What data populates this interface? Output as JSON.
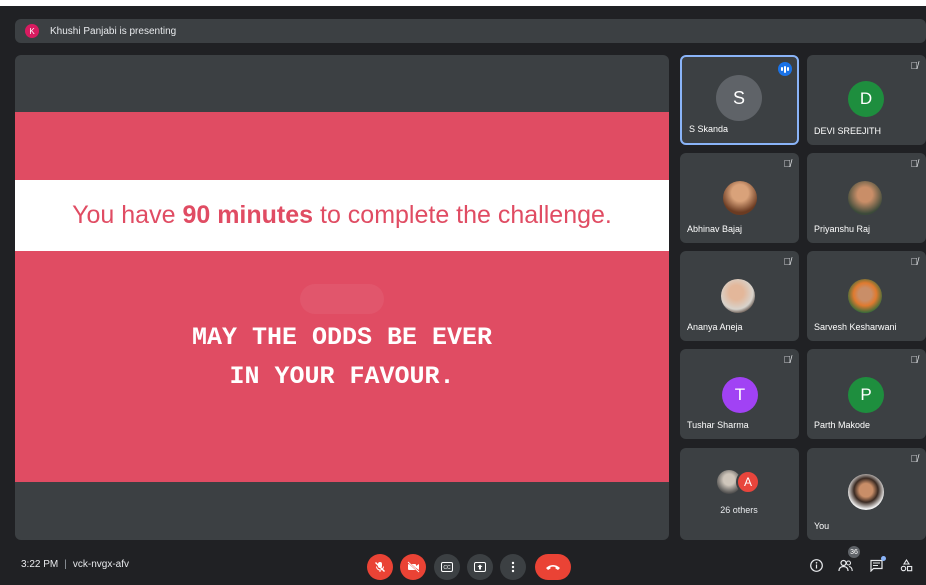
{
  "presentation_banner": {
    "avatar_letter": "K",
    "text": "Khushi Panjabi is presenting"
  },
  "slide": {
    "heading_pre": "You have ",
    "heading_bold": "90 minutes",
    "heading_post": " to complete the challenge.",
    "line1": "MAY THE ODDS BE EVER",
    "line2": "IN YOUR FAVOUR."
  },
  "participants": [
    {
      "name": "S Skanda",
      "initial": "S",
      "avatar_color": "#5f6368",
      "speaking": true
    },
    {
      "name": "DEVI SREEJITH",
      "initial": "D",
      "avatar_color": "#1e8e3e"
    },
    {
      "name": "Abhinav Bajaj"
    },
    {
      "name": "Priyanshu Raj"
    },
    {
      "name": "Ananya Aneja"
    },
    {
      "name": "Sarvesh Kesharwani"
    },
    {
      "name": "Tushar Sharma",
      "initial": "T",
      "avatar_color": "#a142f4"
    },
    {
      "name": "Parth Makode",
      "initial": "P",
      "avatar_color": "#1e8e3e"
    },
    {
      "name": "26 others",
      "initial": "A",
      "avatar_color": "#e8453c"
    },
    {
      "name": "You"
    }
  ],
  "mute_icon": "🎙̸",
  "bottom": {
    "time": "3:22 PM",
    "meeting_code": "vck-nvgx-afv",
    "people_count": "36"
  },
  "colors": {
    "accent": "#8ab4f8",
    "danger": "#ea4335",
    "slide_red": "#e04c63"
  },
  "icons": {
    "mic_off": "mic-off-icon",
    "cam_off": "camera-off-icon",
    "captions": "captions-icon",
    "present": "present-icon",
    "more": "more-options-icon",
    "end": "end-call-icon",
    "info": "info-icon",
    "people": "people-icon",
    "chat": "chat-icon",
    "activities": "activities-icon"
  }
}
